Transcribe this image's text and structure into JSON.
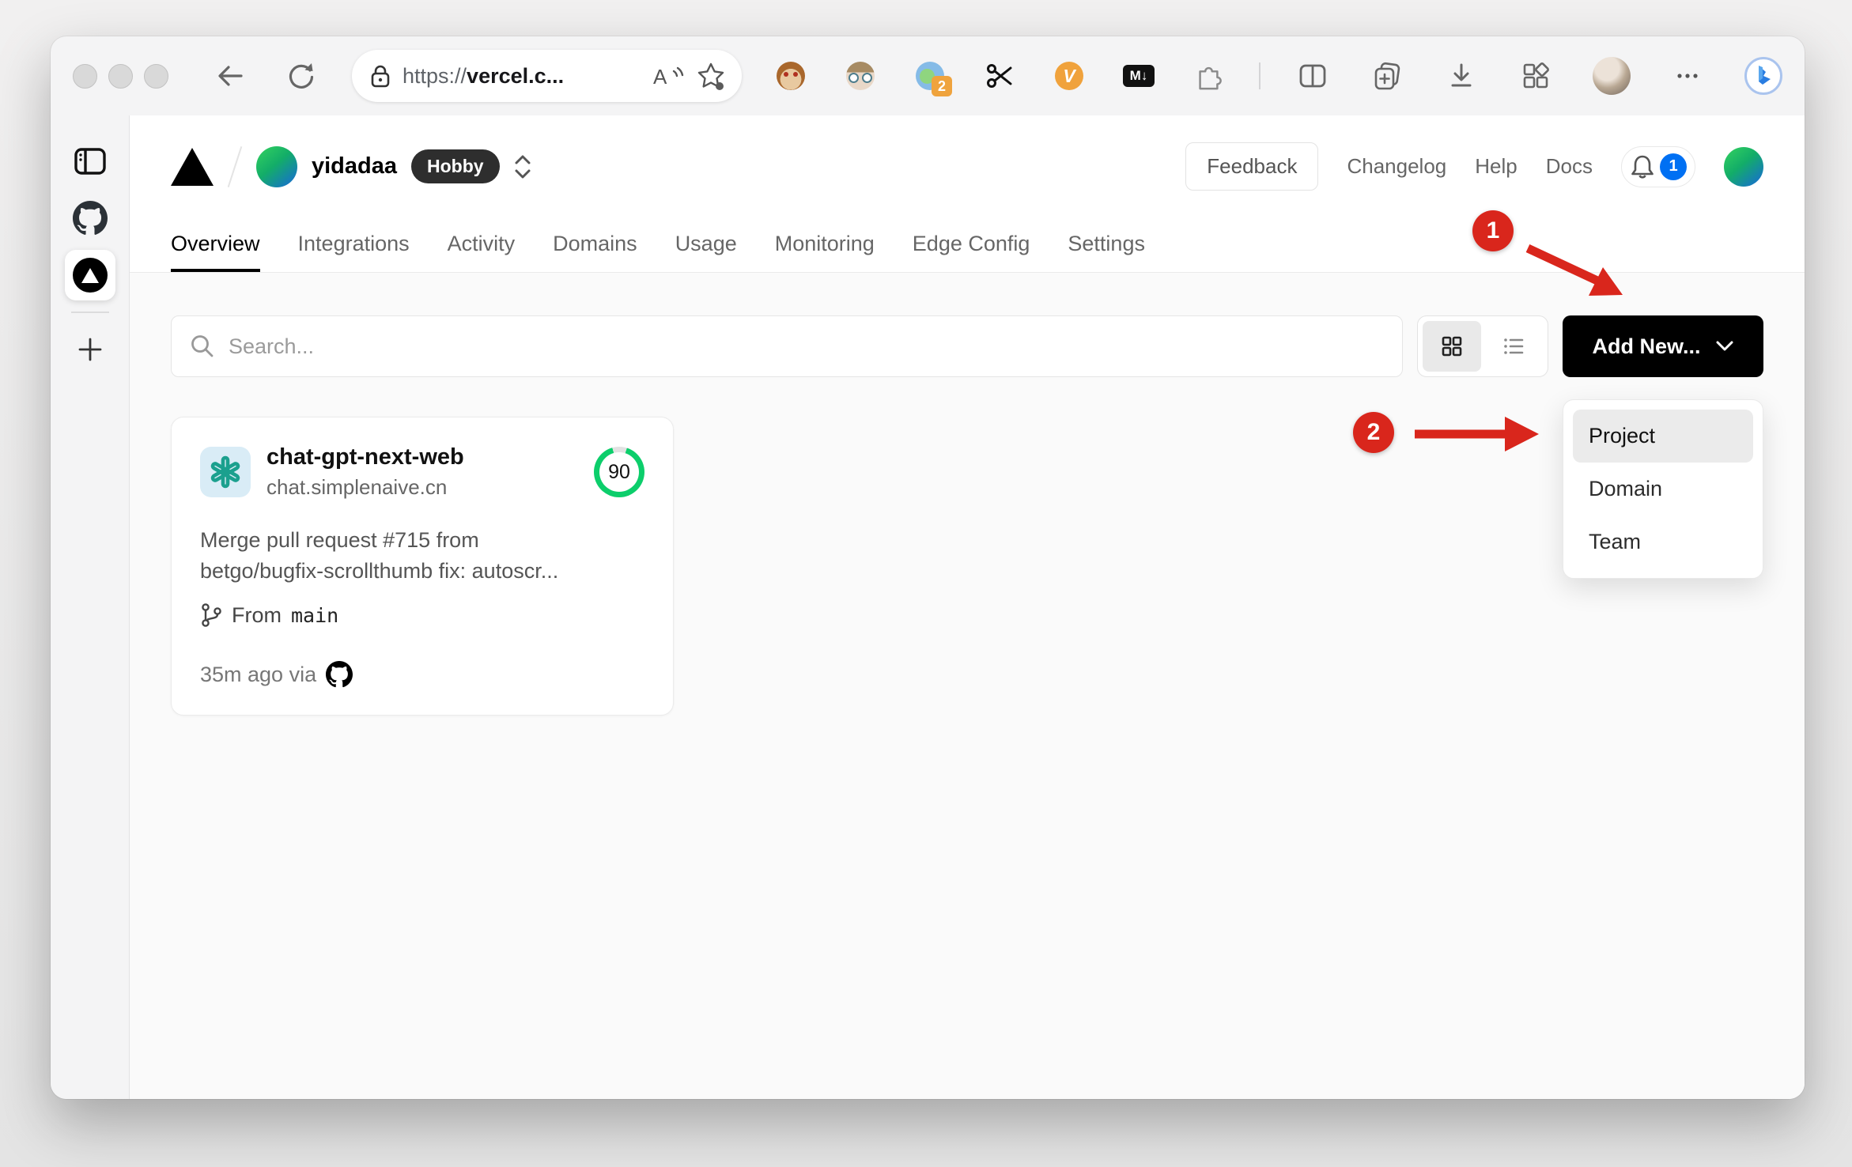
{
  "browser": {
    "url_scheme": "https://",
    "url_host": "vercel.c...",
    "extension_badge_count": "2",
    "markdown_icon_label": "M↓",
    "v_icon_label": "V",
    "bing_icon_label": "b"
  },
  "icons": {
    "toolbar": [
      "back-icon",
      "refresh-icon",
      "lock-icon",
      "read-aloud-icon",
      "favorite-star-icon",
      "tampermonkey-icon",
      "face-extension-icon",
      "translate-extension-icon",
      "scissors-extension-icon",
      "v-extension-icon",
      "markdown-extension-icon",
      "extensions-puzzle-icon",
      "split-screen-icon",
      "collections-icon",
      "downloads-icon",
      "apps-icon",
      "profile-avatar",
      "more-options-icon",
      "bing-chat-icon"
    ],
    "side_rail": [
      "panel-toggle-icon",
      "github-icon",
      "vercel-icon",
      "new-tab-plus-icon"
    ]
  },
  "header": {
    "team_name": "yidadaa",
    "plan_badge": "Hobby",
    "feedback_label": "Feedback",
    "nav_links": [
      "Changelog",
      "Help",
      "Docs"
    ],
    "notification_count": "1"
  },
  "tabs": {
    "items": [
      {
        "label": "Overview",
        "active": true
      },
      {
        "label": "Integrations",
        "active": false
      },
      {
        "label": "Activity",
        "active": false
      },
      {
        "label": "Domains",
        "active": false
      },
      {
        "label": "Usage",
        "active": false
      },
      {
        "label": "Monitoring",
        "active": false
      },
      {
        "label": "Edge Config",
        "active": false
      },
      {
        "label": "Settings",
        "active": false
      }
    ]
  },
  "toolbar": {
    "search_placeholder": "Search...",
    "add_new_label": "Add New..."
  },
  "dropdown": {
    "items": [
      "Project",
      "Domain",
      "Team"
    ],
    "highlighted": "Project"
  },
  "project_card": {
    "name": "chat-gpt-next-web",
    "domain": "chat.simplenaive.cn",
    "score": "90",
    "commit_line1": "Merge pull request #715 from",
    "commit_line2": "betgo/bugfix-scrollthumb fix: autoscr...",
    "branch_prefix": "From",
    "branch_name": "main",
    "deployed_text": "35m ago via"
  },
  "annotations": {
    "color": "#d9261c",
    "steps": [
      {
        "number": "1"
      },
      {
        "number": "2"
      }
    ]
  },
  "colors": {
    "accent_blue": "#0070f3",
    "score_green": "#0cce6b",
    "annotation_red": "#d9261c",
    "add_new_black": "#000000"
  }
}
